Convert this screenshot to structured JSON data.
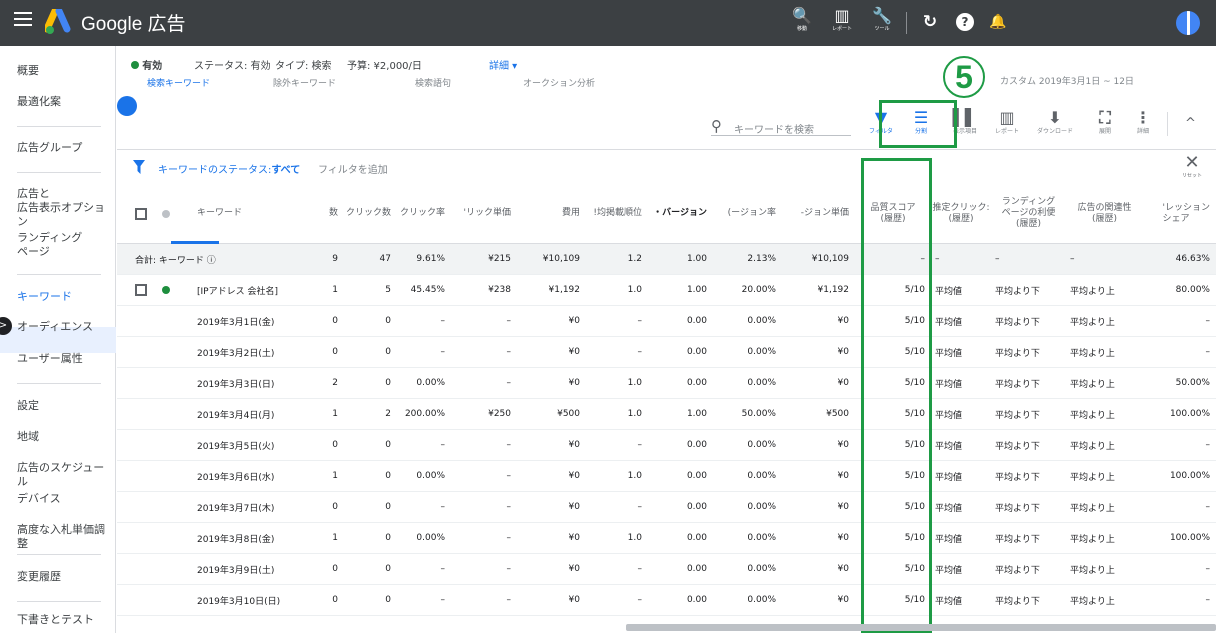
{
  "app": {
    "brand": "Google 広告"
  },
  "top_tools": [
    {
      "label": "移動",
      "glyph": "🔍"
    },
    {
      "label": "レポート",
      "glyph": "▥"
    },
    {
      "label": "ツール",
      "glyph": "🔧"
    }
  ],
  "top_icons": {
    "refresh": "↻",
    "help": "?",
    "bell": "🔔"
  },
  "sidebar": [
    {
      "label": "概要"
    },
    {
      "label": "最適化案"
    },
    {
      "label": "広告グループ"
    },
    {
      "label": "広告と\n広告表示オプション"
    },
    {
      "label": "ランディング\nページ"
    },
    {
      "label": "キーワード",
      "active": true
    },
    {
      "label": "オーディエンス"
    },
    {
      "label": "ユーザー属性"
    },
    {
      "label": "設定"
    },
    {
      "label": "地域"
    },
    {
      "label": "広告のスケジュール"
    },
    {
      "label": "デバイス"
    },
    {
      "label": "高度な入札単価調整"
    },
    {
      "label": "変更履歴"
    },
    {
      "label": "下書きとテスト"
    }
  ],
  "status": {
    "state": "有効",
    "status_text": "ステータス: 有効",
    "type_text": "タイプ: 検索",
    "budget_text": "予算: ¥2,000/日",
    "details": "詳細 ▾"
  },
  "tabs_behind": [
    "検索キーワード",
    "除外キーワード",
    "検索語句",
    "オークション分析"
  ],
  "date_peek": "カスタム 2019年3月1日 ~ 12日",
  "search_placeholder": "キーワードを検索",
  "toolbar_buttons": [
    {
      "name": "filter",
      "label": "フィルタ",
      "glyph": "▼",
      "blue": true
    },
    {
      "name": "segment",
      "label": "分割",
      "glyph": "☰",
      "blue": true
    },
    {
      "name": "columns",
      "label": "表示項目",
      "glyph": "▌▌",
      "blue": false
    },
    {
      "name": "reports",
      "label": "レポート",
      "glyph": "▥",
      "blue": false
    },
    {
      "name": "download",
      "label": "ダウンロード",
      "glyph": "⬇",
      "blue": false
    },
    {
      "name": "expand",
      "label": "展開",
      "glyph": "⛶",
      "blue": false
    },
    {
      "name": "more",
      "label": "詳細",
      "glyph": "⋮",
      "blue": false
    }
  ],
  "collapse_glyph": "^",
  "filter": {
    "prefix": "キーワードのステータス:",
    "value": "すべて",
    "add": "フィルタを追加",
    "close": "✕",
    "reset": "リセット"
  },
  "annotation": {
    "number": "5"
  },
  "table": {
    "columns": [
      {
        "label": "キーワード"
      },
      {
        "label": "数"
      },
      {
        "label": "クリック数"
      },
      {
        "label": "クリック率"
      },
      {
        "label": "'リック単価"
      },
      {
        "label": "費用"
      },
      {
        "label": "!均掲載順位"
      },
      {
        "label": "・バージョン",
        "bold": true
      },
      {
        "label": "(ージョン率"
      },
      {
        "label": "-ジョン単価"
      },
      {
        "label": "品質スコア\n(履歴)"
      },
      {
        "label": "推定クリック:\n(履歴)"
      },
      {
        "label": "ランディング\nページの利便\n(履歴)"
      },
      {
        "label": "広告の関連性\n(履歴)"
      },
      {
        "label": "'レッション\nシェア"
      }
    ],
    "total": [
      "合計: キーワード ⓘ",
      "9",
      "47",
      "9.61%",
      "¥215",
      "¥10,109",
      "1.2",
      "1.00",
      "2.13%",
      "¥10,109",
      "–",
      "–",
      "–",
      "–",
      "46.63%"
    ],
    "rows": [
      {
        "check": true,
        "cells": [
          "[IPアドレス 会社名]",
          "1",
          "5",
          "45.45%",
          "¥238",
          "¥1,192",
          "1.0",
          "1.00",
          "20.00%",
          "¥1,192",
          "5/10",
          "平均値",
          "平均より下",
          "平均より上",
          "80.00%"
        ]
      },
      {
        "check": false,
        "cells": [
          "2019年3月1日(金)",
          "0",
          "0",
          "–",
          "–",
          "¥0",
          "–",
          "0.00",
          "0.00%",
          "¥0",
          "5/10",
          "平均値",
          "平均より下",
          "平均より上",
          "–"
        ]
      },
      {
        "check": false,
        "cells": [
          "2019年3月2日(土)",
          "0",
          "0",
          "–",
          "–",
          "¥0",
          "–",
          "0.00",
          "0.00%",
          "¥0",
          "5/10",
          "平均値",
          "平均より下",
          "平均より上",
          "–"
        ]
      },
      {
        "check": false,
        "cells": [
          "2019年3月3日(日)",
          "2",
          "0",
          "0.00%",
          "–",
          "¥0",
          "1.0",
          "0.00",
          "0.00%",
          "¥0",
          "5/10",
          "平均値",
          "平均より下",
          "平均より上",
          "50.00%"
        ]
      },
      {
        "check": false,
        "cells": [
          "2019年3月4日(月)",
          "1",
          "2",
          "200.00%",
          "¥250",
          "¥500",
          "1.0",
          "1.00",
          "50.00%",
          "¥500",
          "5/10",
          "平均値",
          "平均より下",
          "平均より上",
          "100.00%"
        ]
      },
      {
        "check": false,
        "cells": [
          "2019年3月5日(火)",
          "0",
          "0",
          "–",
          "–",
          "¥0",
          "–",
          "0.00",
          "0.00%",
          "¥0",
          "5/10",
          "平均値",
          "平均より下",
          "平均より上",
          "–"
        ]
      },
      {
        "check": false,
        "cells": [
          "2019年3月6日(水)",
          "1",
          "0",
          "0.00%",
          "–",
          "¥0",
          "1.0",
          "0.00",
          "0.00%",
          "¥0",
          "5/10",
          "平均値",
          "平均より下",
          "平均より上",
          "100.00%"
        ]
      },
      {
        "check": false,
        "cells": [
          "2019年3月7日(木)",
          "0",
          "0",
          "–",
          "–",
          "¥0",
          "–",
          "0.00",
          "0.00%",
          "¥0",
          "5/10",
          "平均値",
          "平均より下",
          "平均より上",
          "–"
        ]
      },
      {
        "check": false,
        "cells": [
          "2019年3月8日(金)",
          "1",
          "0",
          "0.00%",
          "–",
          "¥0",
          "1.0",
          "0.00",
          "0.00%",
          "¥0",
          "5/10",
          "平均値",
          "平均より下",
          "平均より上",
          "100.00%"
        ]
      },
      {
        "check": false,
        "cells": [
          "2019年3月9日(土)",
          "0",
          "0",
          "–",
          "–",
          "¥0",
          "–",
          "0.00",
          "0.00%",
          "¥0",
          "5/10",
          "平均値",
          "平均より下",
          "平均より上",
          "–"
        ]
      },
      {
        "check": false,
        "cells": [
          "2019年3月10日(日)",
          "0",
          "0",
          "–",
          "–",
          "¥0",
          "–",
          "0.00",
          "0.00%",
          "¥0",
          "5/10",
          "平均値",
          "平均より下",
          "平均より上",
          "–"
        ]
      }
    ]
  },
  "colors": {
    "brand_blue": "#1a73e8",
    "status_green": "#1e8e3e",
    "annotation_green": "#1e9b45",
    "topbar": "#3c4043"
  }
}
